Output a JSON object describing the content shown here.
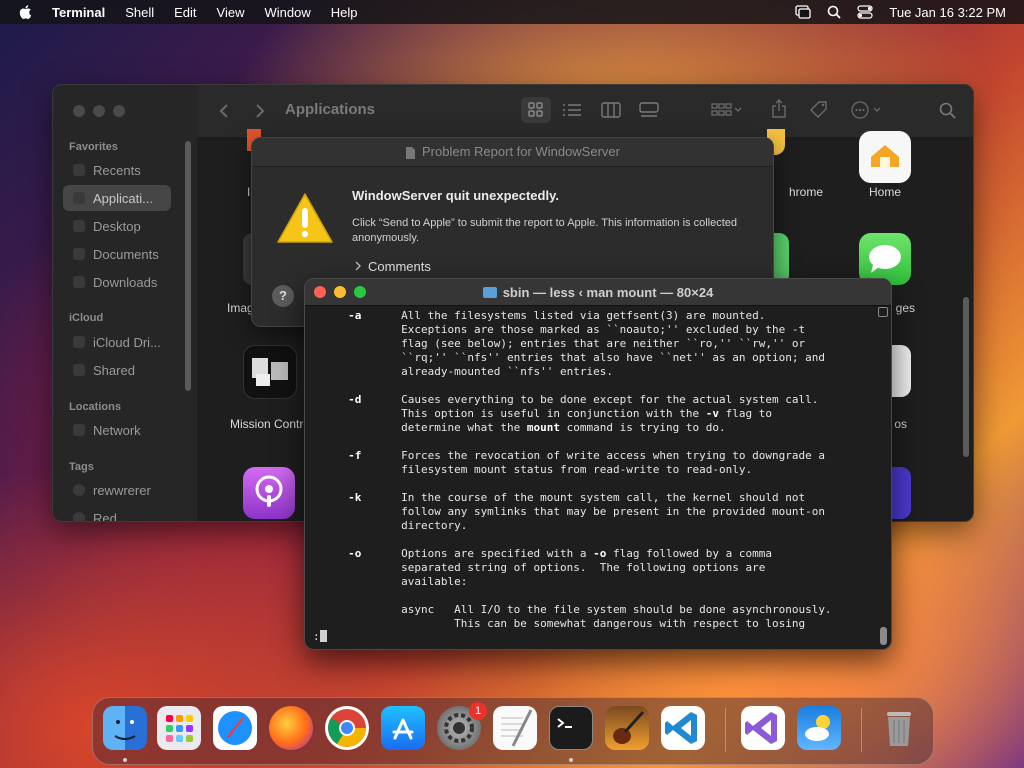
{
  "menubar": {
    "app_name": "Terminal",
    "items": [
      "Shell",
      "Edit",
      "View",
      "Window",
      "Help"
    ],
    "datetime": "Tue Jan 16  3:22 PM"
  },
  "finder": {
    "title": "Applications",
    "sidebar": {
      "favorites_header": "Favorites",
      "favorites": [
        "Recents",
        "Applicati...",
        "Desktop",
        "Documents",
        "Downloads"
      ],
      "icloud_header": "iCloud",
      "icloud": [
        "iCloud Dri...",
        "Shared"
      ],
      "locations_header": "Locations",
      "locations": [
        "Network"
      ],
      "tags_header": "Tags",
      "tags": [
        "rewwrerer",
        "Red"
      ]
    },
    "apps": {
      "chrome_partial": "hrome",
      "home": "Home",
      "messages_partial": "ges",
      "photos_partial": "os",
      "image_partial": "Imag",
      "i_partial": "I",
      "mission_control": "Mission Contro"
    }
  },
  "report": {
    "title": "Problem Report for WindowServer",
    "headline": "WindowServer quit unexpectedly.",
    "body": "Click “Send to Apple” to submit the report to Apple. This information is collected anonymously.",
    "comments": "Comments",
    "help": "?"
  },
  "terminal": {
    "title": "sbin — less ‹ man mount — 80×24",
    "prompt": ":",
    "lines": [
      "     -a      All the filesystems listed via getfsent(3) are mounted.",
      "             Exceptions are those marked as ``noauto;'' excluded by the -t",
      "             flag (see below); entries that are neither ``ro,'' ``rw,'' or",
      "             ``rq;'' ``nfs'' entries that also have ``net'' as an option; and",
      "             already-mounted ``nfs'' entries.",
      "",
      "     -d      Causes everything to be done except for the actual system call.",
      "             This option is useful in conjunction with the -v flag to",
      "             determine what the mount command is trying to do.",
      "",
      "     -f      Forces the revocation of write access when trying to downgrade a",
      "             filesystem mount status from read-write to read-only.",
      "",
      "     -k      In the course of the mount system call, the kernel should not",
      "             follow any symlinks that may be present in the provided mount-on",
      "             directory.",
      "",
      "     -o      Options are specified with a -o flag followed by a comma",
      "             separated string of options.  The following options are",
      "             available:",
      "",
      "             async   All I/O to the file system should be done asynchronously.",
      "                     This can be somewhat dangerous with respect to losing"
    ]
  },
  "dock": {
    "apps": [
      "finder-icon",
      "launchpad-icon",
      "safari-icon",
      "firefox-icon",
      "chrome-icon",
      "app-store-icon",
      "system-settings-icon",
      "textedit-icon",
      "terminal-icon",
      "garageband-icon",
      "vscode-icon",
      "visual-studio-icon",
      "weather-icon",
      "trash-icon"
    ],
    "settings_badge": "1"
  }
}
